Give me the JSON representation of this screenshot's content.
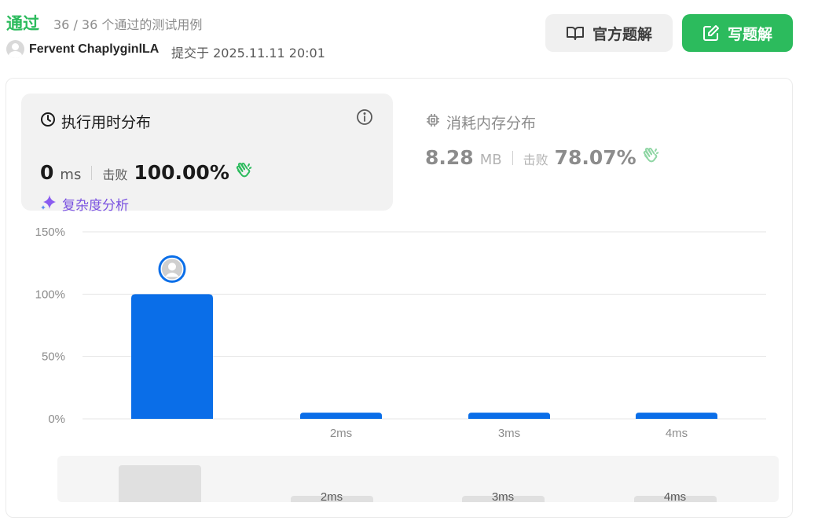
{
  "header": {
    "status": "通过",
    "testcases": "36 / 36 个通过的测试用例",
    "username": "Fervent ChaplyginlLA",
    "submitted": "提交于 2025.11.11 20:01"
  },
  "buttons": {
    "official_solution": "官方题解",
    "write_solution": "写题解"
  },
  "runtime": {
    "title": "执行用时分布",
    "value": "0",
    "unit": "ms",
    "beat_label": "击败",
    "beat_pct": "100.00%",
    "complexity_link": "复杂度分析"
  },
  "memory": {
    "title": "消耗内存分布",
    "value": "8.28",
    "unit": "MB",
    "beat_label": "击败",
    "beat_pct": "78.07%"
  },
  "colors": {
    "accent_green": "#2cbb5d",
    "bar_blue": "#0a6ee8",
    "grid": "#e6e6e6",
    "purple": "#7a52e0"
  },
  "chart_data": {
    "type": "bar",
    "categories": [
      "",
      "2ms",
      "3ms",
      "4ms"
    ],
    "values": [
      100,
      5,
      5,
      5
    ],
    "ylim": [
      0,
      150
    ],
    "yticks": [
      "0%",
      "50%",
      "100%",
      "150%"
    ],
    "ytick_values": [
      0,
      50,
      100,
      150
    ],
    "highlight_index": 0,
    "grid": true
  },
  "minimap": {
    "labels": [
      "2ms",
      "3ms",
      "4ms"
    ]
  }
}
